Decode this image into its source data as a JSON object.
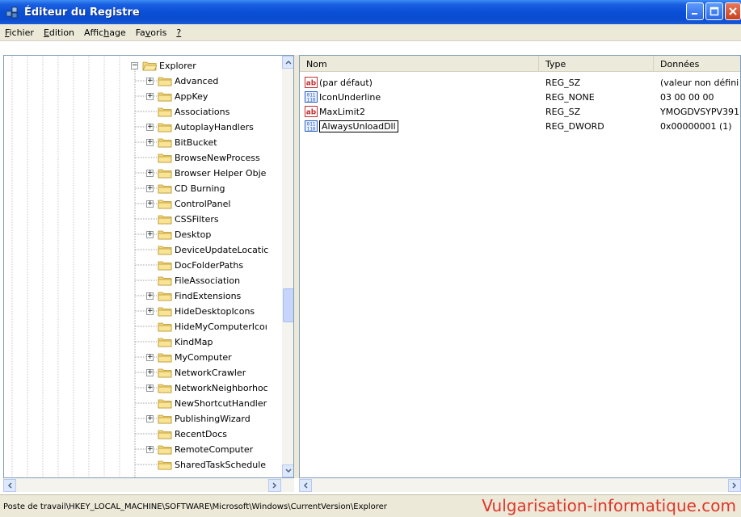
{
  "window": {
    "title": "Éditeur du Registre"
  },
  "menu": [
    {
      "label": "Fichier",
      "u": "F"
    },
    {
      "label": "Edition",
      "u": "E"
    },
    {
      "label": "Affichage",
      "u": "h"
    },
    {
      "label": "Favoris",
      "u": "v"
    },
    {
      "label": "?",
      "u": "?"
    }
  ],
  "tree": {
    "root": "Explorer",
    "items": [
      {
        "label": "Advanced",
        "expandable": true
      },
      {
        "label": "AppKey",
        "expandable": true
      },
      {
        "label": "Associations",
        "expandable": false
      },
      {
        "label": "AutoplayHandlers",
        "expandable": true
      },
      {
        "label": "BitBucket",
        "expandable": true
      },
      {
        "label": "BrowseNewProcess",
        "expandable": false
      },
      {
        "label": "Browser Helper Obje",
        "expandable": true
      },
      {
        "label": "CD Burning",
        "expandable": true
      },
      {
        "label": "ControlPanel",
        "expandable": true
      },
      {
        "label": "CSSFilters",
        "expandable": false
      },
      {
        "label": "Desktop",
        "expandable": true
      },
      {
        "label": "DeviceUpdateLocatic",
        "expandable": false
      },
      {
        "label": "DocFolderPaths",
        "expandable": false
      },
      {
        "label": "FileAssociation",
        "expandable": false
      },
      {
        "label": "FindExtensions",
        "expandable": true
      },
      {
        "label": "HideDesktopIcons",
        "expandable": true
      },
      {
        "label": "HideMyComputerIcoı",
        "expandable": false
      },
      {
        "label": "KindMap",
        "expandable": false
      },
      {
        "label": "MyComputer",
        "expandable": true
      },
      {
        "label": "NetworkCrawler",
        "expandable": true
      },
      {
        "label": "NetworkNeighborhoc",
        "expandable": true
      },
      {
        "label": "NewShortcutHandler",
        "expandable": false
      },
      {
        "label": "PublishingWizard",
        "expandable": true
      },
      {
        "label": "RecentDocs",
        "expandable": false
      },
      {
        "label": "RemoteComputer",
        "expandable": true
      },
      {
        "label": "SharedTaskSchedule",
        "expandable": false
      }
    ]
  },
  "list": {
    "columns": [
      "Nom",
      "Type",
      "Données"
    ],
    "rows": [
      {
        "name": "(par défaut)",
        "type": "REG_SZ",
        "data": "(valeur non défini",
        "icon": "string-value-icon"
      },
      {
        "name": "IconUnderline",
        "type": "REG_NONE",
        "data": "03 00 00 00",
        "icon": "binary-value-icon"
      },
      {
        "name": "MaxLimit2",
        "type": "REG_SZ",
        "data": "YMOGDVSYPV391",
        "icon": "string-value-icon"
      },
      {
        "name": "AlwaysUnloadDll",
        "type": "REG_DWORD",
        "data": "0x00000001 (1)",
        "icon": "binary-value-icon"
      }
    ]
  },
  "status": {
    "path": "Poste de travail\\HKEY_LOCAL_MACHINE\\SOFTWARE\\Microsoft\\Windows\\CurrentVersion\\Explorer",
    "watermark": "Vulgarisation-informatique.com"
  },
  "colors": {
    "titlebar": "#0a4fd6",
    "watermark": "#e0352a",
    "selection": "#000000"
  }
}
